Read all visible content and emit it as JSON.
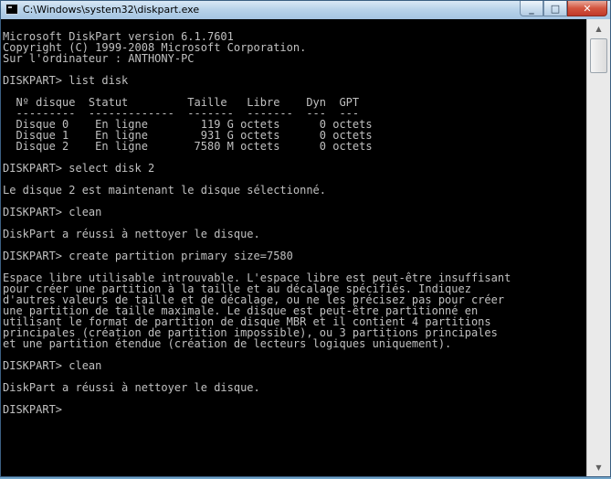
{
  "window": {
    "title": "C:\\Windows\\system32\\diskpart.exe",
    "controls": {
      "minimize": "_",
      "maximize": "□",
      "close": "✕"
    },
    "icons": {
      "app": "console-icon",
      "scroll_up": "arrow-up-icon",
      "scroll_down": "arrow-down-icon"
    },
    "scroll_position": 0.0
  },
  "console": {
    "lines": [
      "Microsoft DiskPart version 6.1.7601",
      "Copyright (C) 1999-2008 Microsoft Corporation.",
      "Sur l'ordinateur : ANTHONY-PC",
      "",
      "DISKPART> list disk",
      "",
      "  Nº disque  Statut         Taille   Libre    Dyn  GPT",
      "  ---------  -------------  -------  -------  ---  ---",
      "  Disque 0    En ligne        119 G octets      0 octets",
      "  Disque 1    En ligne        931 G octets      0 octets",
      "  Disque 2    En ligne       7580 M octets      0 octets",
      "",
      "DISKPART> select disk 2",
      "",
      "Le disque 2 est maintenant le disque sélectionné.",
      "",
      "DISKPART> clean",
      "",
      "DiskPart a réussi à nettoyer le disque.",
      "",
      "DISKPART> create partition primary size=7580",
      "",
      "Espace libre utilisable introuvable. L'espace libre est peut-être insuffisant",
      "pour créer une partition à la taille et au décalage spécifiés. Indiquez",
      "d'autres valeurs de taille et de décalage, ou ne les précisez pas pour créer",
      "une partition de taille maximale. Le disque est peut-être partitionné en",
      "utilisant le format de partition de disque MBR et il contient 4 partitions",
      "principales (création de partition impossible), ou 3 partitions principales",
      "et une partition étendue (création de lecteurs logiques uniquement).",
      "",
      "DISKPART> clean",
      "",
      "DiskPart a réussi à nettoyer le disque.",
      "",
      "DISKPART> "
    ]
  }
}
